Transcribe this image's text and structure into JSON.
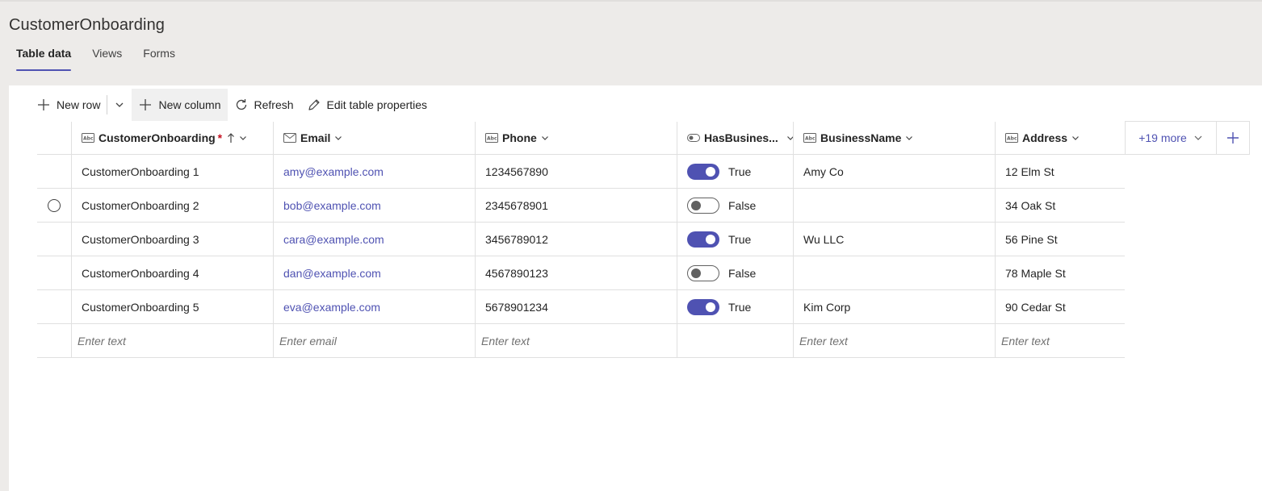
{
  "app": {
    "title": "CustomerOnboarding"
  },
  "tabs": [
    {
      "label": "Table data",
      "active": true
    },
    {
      "label": "Views",
      "active": false
    },
    {
      "label": "Forms",
      "active": false
    }
  ],
  "toolbar": {
    "new_row": "New row",
    "new_column": "New column",
    "refresh": "Refresh",
    "edit_props": "Edit table properties"
  },
  "columns": [
    {
      "label": "CustomerOnboarding",
      "icon": "text-field-icon",
      "required_mark": "*"
    },
    {
      "label": "Email",
      "icon": "mail-icon"
    },
    {
      "label": "Phone",
      "icon": "text-field-icon"
    },
    {
      "label": "HasBusines...",
      "icon": "toggle-field-icon"
    },
    {
      "label": "BusinessName",
      "icon": "text-field-icon"
    },
    {
      "label": "Address",
      "icon": "text-field-icon"
    }
  ],
  "more_columns": "+19 more",
  "rows": [
    {
      "name": "CustomerOnboarding 1",
      "email": "amy@example.com",
      "phone": "1234567890",
      "has_business": true,
      "has_business_label": "True",
      "business_name": "Amy Co",
      "address": "12 Elm St"
    },
    {
      "name": "CustomerOnboarding 2",
      "email": "bob@example.com",
      "phone": "2345678901",
      "has_business": false,
      "has_business_label": "False",
      "business_name": "",
      "address": "34 Oak St"
    },
    {
      "name": "CustomerOnboarding 3",
      "email": "cara@example.com",
      "phone": "3456789012",
      "has_business": true,
      "has_business_label": "True",
      "business_name": "Wu LLC",
      "address": "56 Pine St"
    },
    {
      "name": "CustomerOnboarding 4",
      "email": "dan@example.com",
      "phone": "4567890123",
      "has_business": false,
      "has_business_label": "False",
      "business_name": "",
      "address": "78 Maple St"
    },
    {
      "name": "CustomerOnboarding 5",
      "email": "eva@example.com",
      "phone": "5678901234",
      "has_business": true,
      "has_business_label": "True",
      "business_name": "Kim Corp",
      "address": "90 Cedar St"
    }
  ],
  "new_row_placeholders": {
    "name": "Enter text",
    "email": "Enter email",
    "phone": "Enter text",
    "business_name": "Enter text",
    "address": "Enter text"
  },
  "colors": {
    "accent": "#4f52b2",
    "required": "#c50f1f",
    "background": "#edebe9"
  }
}
